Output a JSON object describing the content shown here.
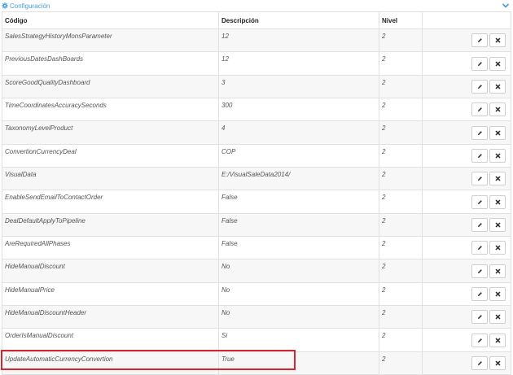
{
  "panel": {
    "title": "Configuración"
  },
  "columns": {
    "code": "Código",
    "description": "Descripción",
    "level": "Nivel"
  },
  "rows": [
    {
      "code": "SalesStrategyHistoryMonsParameter",
      "description": "12",
      "level": "2"
    },
    {
      "code": "PreviousDatesDashBoards",
      "description": "12",
      "level": "2"
    },
    {
      "code": "ScoreGoodQualityDashboard",
      "description": "3",
      "level": "2"
    },
    {
      "code": "TimeCoordinatesAccuracySeconds",
      "description": "300",
      "level": "2"
    },
    {
      "code": "TaxonomyLevelProduct",
      "description": "4",
      "level": "2"
    },
    {
      "code": "ConvertionCurrencyDeal",
      "description": "COP",
      "level": "2"
    },
    {
      "code": "VisualData",
      "description": "E:/VisualSaleData2014/",
      "level": "2"
    },
    {
      "code": "EnableSendEmailToContactOrder",
      "description": "False",
      "level": "2"
    },
    {
      "code": "DealDefaultApplyToPipeline",
      "description": "False",
      "level": "2"
    },
    {
      "code": "AreRequiredAllPhases",
      "description": "False",
      "level": "2"
    },
    {
      "code": "HideManualDiscount",
      "description": "No",
      "level": "2"
    },
    {
      "code": "HideManualPrice",
      "description": "No",
      "level": "2"
    },
    {
      "code": "HideManualDiscountHeader",
      "description": "No",
      "level": "2"
    },
    {
      "code": "OrderIsManualDiscount",
      "description": "Si",
      "level": "2"
    },
    {
      "code": "UpdateAutomaticCurrencyConvertion",
      "description": "True",
      "level": "2"
    }
  ],
  "icons": {
    "edit": "pencil-icon",
    "delete": "close-icon",
    "header": "gear-icon",
    "toggle": "chevron-down-icon"
  },
  "colors": {
    "accent": "#4a9fd8",
    "highlight": "#d0282f",
    "border": "#e1e1e1",
    "row_alt": "#f7f7f7"
  }
}
